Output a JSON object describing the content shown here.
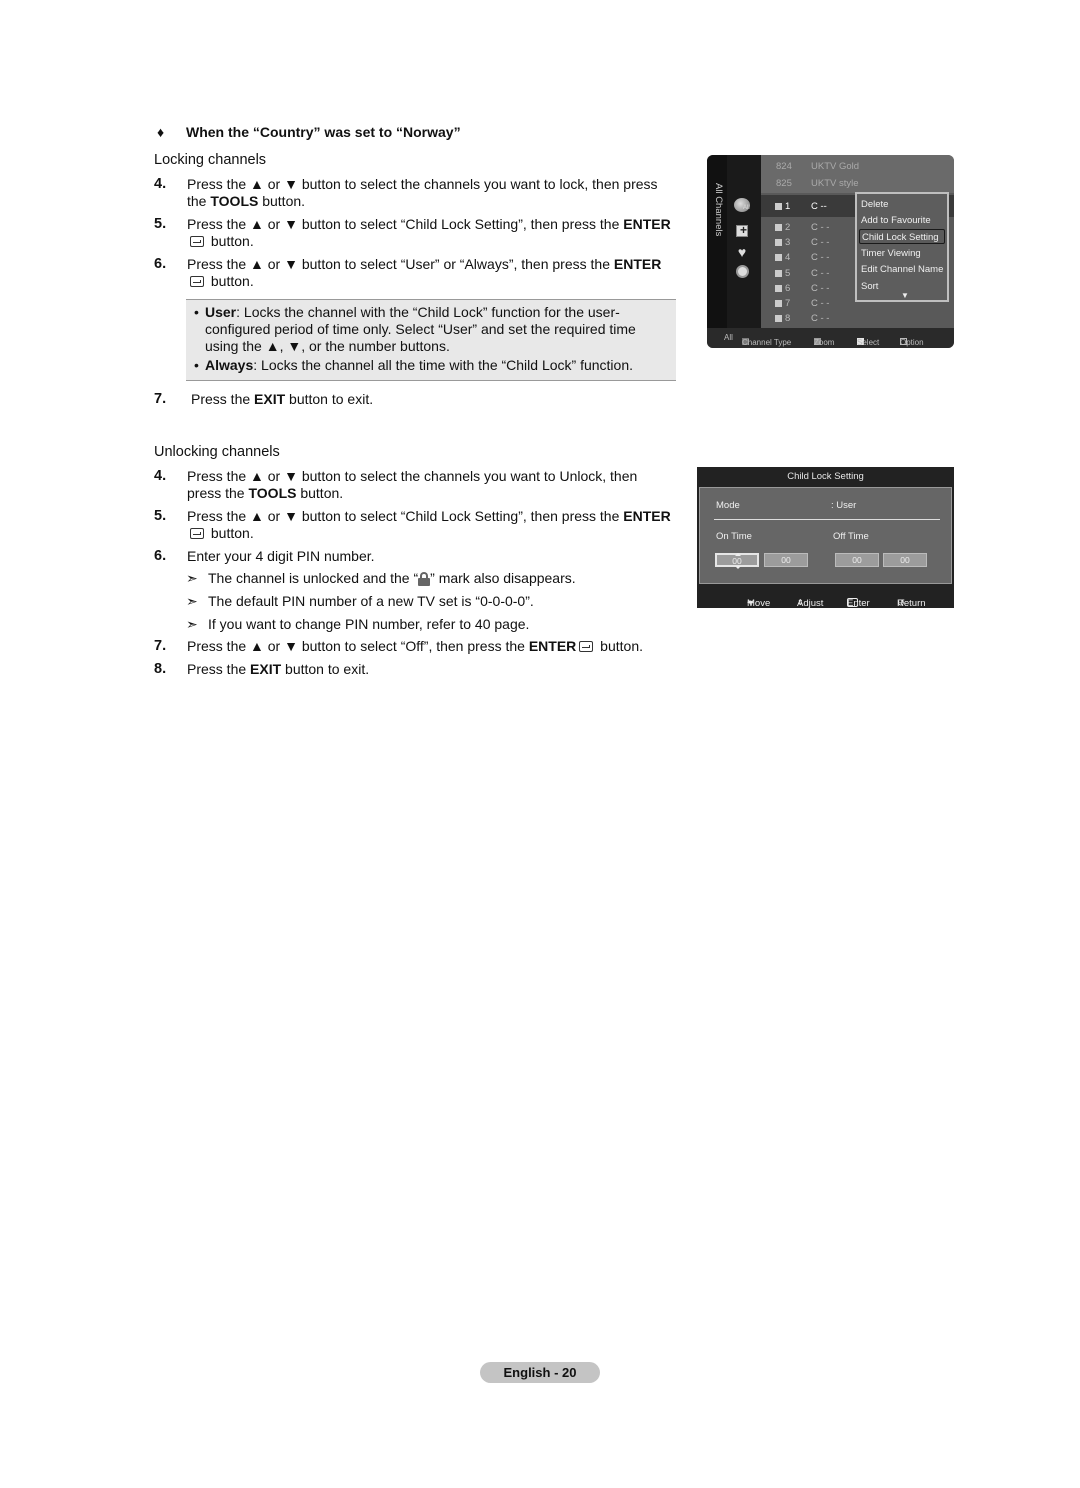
{
  "condition_heading": {
    "bullet": "♦",
    "text": "When the “Country” was set to “Norway”"
  },
  "locking": {
    "title": "Locking channels",
    "steps": [
      {
        "num": "4.",
        "pre": "Press the ▲ or ▼ button to select the channels you want to lock, then press the ",
        "bold": "TOOLS",
        "post": " button."
      },
      {
        "num": "5.",
        "pre": "Press the ▲ or ▼ button to select “Child Lock Setting”, then press the ",
        "bold": "ENTER",
        "post": " button."
      },
      {
        "num": "6.",
        "pre": "Press the ▲ or ▼ button to select “User” or “Always”, then press the ",
        "bold": "ENTER",
        "post": " button."
      }
    ],
    "notes": [
      {
        "bold": "User",
        "text": ": Locks the channel with the “Child Lock” function for the user-configured period of time only. Select “User” and set the required time using the ▲, ▼, or the number buttons."
      },
      {
        "bold": "Always",
        "text": ": Locks the channel all the time with the “Child Lock” function."
      }
    ],
    "step7": {
      "num": "7.",
      "pre": "Press the ",
      "bold": "EXIT",
      "post": " button to exit."
    }
  },
  "unlocking": {
    "title": "Unlocking channels",
    "steps": [
      {
        "num": "4.",
        "pre": "Press the ▲ or ▼ button to select the channels you want to Unlock, then press the ",
        "bold": "TOOLS",
        "post": " button."
      },
      {
        "num": "5.",
        "pre": "Press the ▲ or ▼ button to select “Child Lock Setting”, then press the ",
        "bold": "ENTER",
        "post": " button."
      },
      {
        "num": "6.",
        "text": "Enter your 4 digit PIN number."
      }
    ],
    "arrow_notes": [
      {
        "arrow": "➣",
        "pre": "The channel is unlocked and the “",
        "post": "” mark also disappears."
      },
      {
        "arrow": "➣",
        "text": "The default PIN number of a new TV set is “0-0-0-0”."
      },
      {
        "arrow": "➣",
        "text": "If you want to change PIN number, refer to 40 page."
      }
    ],
    "step7": {
      "num": "7.",
      "pre": "Press the ▲ or ▼ button to select “Off”, then press the ",
      "bold": "ENTER",
      "post": " button."
    },
    "step8": {
      "num": "8.",
      "pre": "Press the ",
      "bold": "EXIT",
      "post": " button to exit."
    }
  },
  "channel_list_screen": {
    "sidebar_label": "All Channels",
    "sidebar_icons": [
      "satellite-all-icon",
      "add-channel-icon",
      "favourite-heart-icon",
      "timer-clock-icon"
    ],
    "sat_icon_label": "All",
    "top_channels": [
      {
        "num": "824",
        "name": "UKTV Gold"
      },
      {
        "num": "825",
        "name": "UKTV style"
      }
    ],
    "channels": [
      {
        "badge": "A",
        "num": "1",
        "name": "C --",
        "selected": true
      },
      {
        "badge": "A",
        "num": "2",
        "name": "C - -"
      },
      {
        "badge": "A",
        "num": "3",
        "name": "C - -"
      },
      {
        "badge": "A",
        "num": "4",
        "name": "C - -"
      },
      {
        "badge": "A",
        "num": "5",
        "name": "C - -"
      },
      {
        "badge": "A",
        "num": "6",
        "name": "C - -"
      },
      {
        "badge": "A",
        "num": "7",
        "name": "C - -"
      },
      {
        "badge": "A",
        "num": "8",
        "name": "C - -"
      }
    ],
    "context_menu": {
      "items": [
        "Delete",
        "Add to Favourite",
        "Child Lock Setting",
        "Timer Viewing",
        "Edit Channel Name",
        "Sort"
      ],
      "active_index": 2,
      "more_indicator": "▼"
    },
    "footer": {
      "all": "All",
      "channel_type": "Channel Type",
      "zoom": "Zoom",
      "select": "Select",
      "option": "Option",
      "colors": {
        "channel_type": "#7a7a7a",
        "zoom": "#9a9a9a",
        "select": "#e6e6e6"
      }
    }
  },
  "child_lock_screen": {
    "title": "Child Lock Setting",
    "mode_label": "Mode",
    "mode_value": ": User",
    "on_time_label": "On Time",
    "off_time_label": "Off Time",
    "on_time": [
      "00",
      "00"
    ],
    "off_time": [
      "00",
      "00"
    ],
    "footer": {
      "move": "Move",
      "adjust": "Adjust",
      "enter": "Enter",
      "return": "Return"
    }
  },
  "page_footer": {
    "label": "English - 20"
  }
}
